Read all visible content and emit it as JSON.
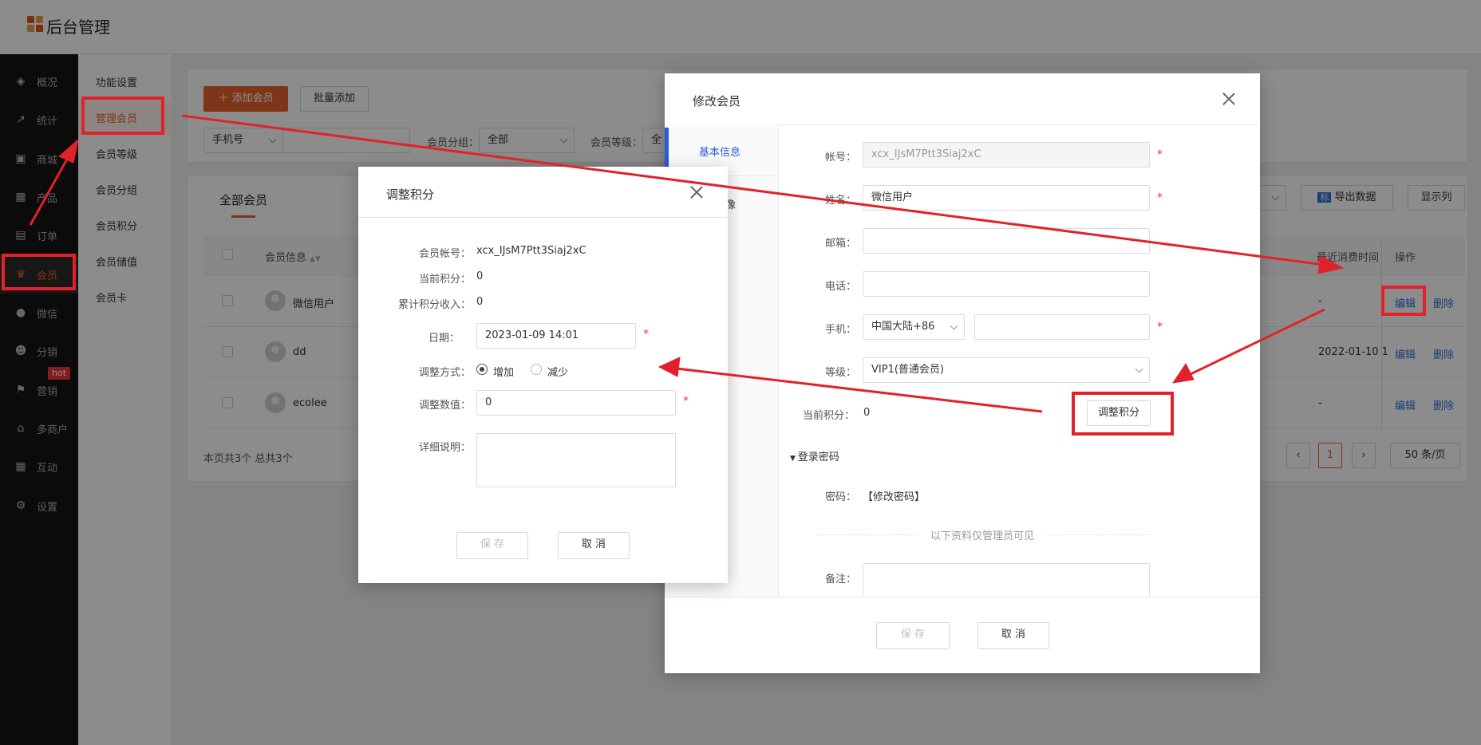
{
  "app": {
    "title": "后台管理"
  },
  "sidebar": {
    "items": [
      {
        "label": "概况",
        "icon": "layers-icon"
      },
      {
        "label": "统计",
        "icon": "chart-icon"
      },
      {
        "label": "商城",
        "icon": "shop-icon"
      },
      {
        "label": "产品",
        "icon": "grid-icon"
      },
      {
        "label": "订单",
        "icon": "clipboard-icon"
      },
      {
        "label": "会员",
        "icon": "crown-icon"
      },
      {
        "label": "微信",
        "icon": "wechat-icon"
      },
      {
        "label": "分销",
        "icon": "users-icon"
      },
      {
        "label": "营销",
        "icon": "flag-icon"
      },
      {
        "label": "多商户",
        "icon": "store-icon"
      },
      {
        "label": "互动",
        "icon": "grid-icon"
      },
      {
        "label": "设置",
        "icon": "gear-icon"
      }
    ],
    "hot_badge": "hot"
  },
  "subnav": {
    "items": [
      "功能设置",
      "管理会员",
      "会员等级",
      "会员分组",
      "会员积分",
      "会员储值",
      "会员卡"
    ]
  },
  "toolbar": {
    "add_member": "添加会员",
    "batch_add": "批量添加",
    "search_type": "手机号",
    "group_label": "会员分组：",
    "group_value": "全部",
    "level_label": "会员等级：",
    "level_value": "全",
    "export": "导出数据",
    "export_badge": "标",
    "columns": "显示列"
  },
  "table": {
    "tab": "全部会员",
    "headers": {
      "info": "会员信息",
      "last_time": "最近消费时间",
      "ops": "操作"
    },
    "rows": [
      {
        "name": "微信用户",
        "last_time": "-",
        "edit": "编辑",
        "delete": "删除"
      },
      {
        "name": "dd",
        "last_time": "2022-01-10 1",
        "edit": "编辑",
        "delete": "删除"
      },
      {
        "name": "ecolee",
        "last_time": "-",
        "edit": "编辑",
        "delete": "删除"
      }
    ],
    "summary": "本页共3个 总共3个",
    "page": "1",
    "per_page": "50 条/页"
  },
  "edit_modal": {
    "title": "修改会员",
    "tabs": [
      "基本信息",
      "头像"
    ],
    "fields": {
      "account_label": "帐号：",
      "account_value": "xcx_IJsM7Ptt3Siaj2xC",
      "name_label": "姓名：",
      "name_value": "微信用户",
      "email_label": "邮箱：",
      "phone_label": "电话：",
      "mobile_label": "手机：",
      "mobile_region": "中国大陆+86",
      "level_label": "等级：",
      "level_value": "VIP1(普通会员)",
      "points_label": "当前积分：",
      "points_value": "0",
      "adjust_btn": "调整积分",
      "pwd_section": "登录密码",
      "pwd_label": "密码：",
      "pwd_link": "【修改密码】",
      "admin_only": "以下资料仅管理员可见",
      "remark_label": "备注："
    },
    "save": "保 存",
    "cancel": "取 消"
  },
  "points_modal": {
    "title": "调整积分",
    "account_label": "会员帐号：",
    "account_value": "xcx_IJsM7Ptt3Siaj2xC",
    "current_label": "当前积分：",
    "current_value": "0",
    "total_label": "累计积分收入：",
    "total_value": "0",
    "date_label": "日期：",
    "date_value": "2023-01-09 14:01",
    "method_label": "调整方式：",
    "method_add": "增加",
    "method_sub": "减少",
    "amount_label": "调整数值：",
    "amount_value": "0",
    "detail_label": "详细说明：",
    "save": "保 存",
    "cancel": "取 消"
  },
  "annotation_color": "#e2222b"
}
